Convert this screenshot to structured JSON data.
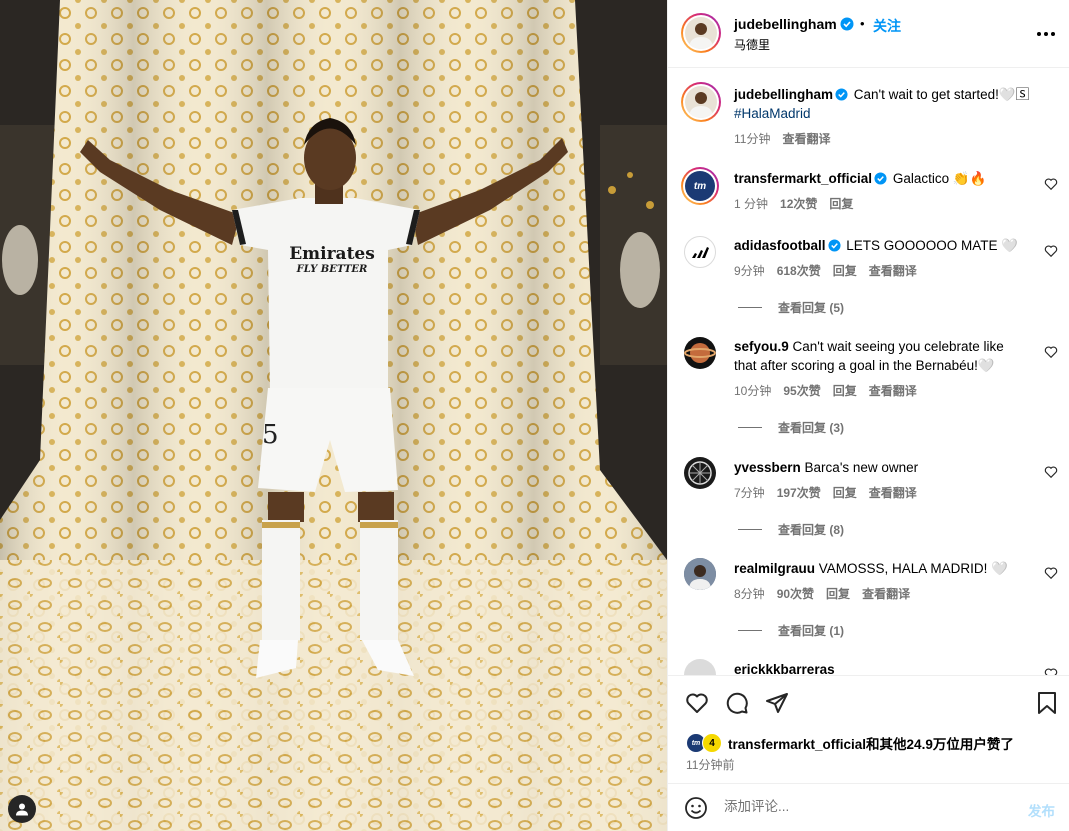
{
  "post": {
    "username": "judebellingham",
    "follow_label": "关注",
    "separator": "•",
    "location": "马德里",
    "caption_user": "judebellingham",
    "caption_text": " Can't wait to get started!🤍🅂",
    "caption_hashtag": "#HalaMadrid",
    "caption_time": "11分钟",
    "caption_translate": "查看翻译"
  },
  "comments": [
    {
      "username": "transfermarkt_official",
      "verified": true,
      "text": " Galactico 👏🔥",
      "time": "1 分钟",
      "likes": "12次赞",
      "reply": "回复",
      "translate": "",
      "replies_label": ""
    },
    {
      "username": "adidasfootball",
      "verified": true,
      "text": " LETS GOOOOOO MATE 🤍",
      "time": "9分钟",
      "likes": "618次赞",
      "reply": "回复",
      "translate": "查看翻译",
      "replies_label": "查看回复 (5)"
    },
    {
      "username": "sefyou.9",
      "verified": false,
      "text": " Can't wait seeing you celebrate like that after scoring a goal in the Bernabéu!🤍",
      "time": "10分钟",
      "likes": "95次赞",
      "reply": "回复",
      "translate": "查看翻译",
      "replies_label": "查看回复 (3)"
    },
    {
      "username": "yvessbern",
      "verified": false,
      "text": " Barca's new owner",
      "time": "7分钟",
      "likes": "197次赞",
      "reply": "回复",
      "translate": "查看翻译",
      "replies_label": "查看回复 (8)"
    },
    {
      "username": "realmilgrauu",
      "verified": false,
      "text": " VAMOSSS, HALA MADRID! 🤍",
      "time": "8分钟",
      "likes": "90次赞",
      "reply": "回复",
      "translate": "查看翻译",
      "replies_label": "查看回复 (1)"
    },
    {
      "username": "erickkkbarreras",
      "verified": false,
      "text": "",
      "time": "",
      "likes": "",
      "reply": "",
      "translate": "",
      "replies_label": ""
    }
  ],
  "likes_summary": "transfermarkt_official和其他24.9万位用户赞了",
  "post_time": "11分钟前",
  "composer": {
    "placeholder": "添加评论...",
    "post_label": "发布"
  },
  "photo": {
    "jersey_sponsor_line1": "Emirates",
    "jersey_sponsor_line2": "FLY BETTER",
    "shorts_number": "5"
  },
  "icons": {
    "verified": "verified-badge-icon",
    "more": "more-options-icon",
    "like": "heart-icon",
    "comment": "comment-icon",
    "share": "send-icon",
    "save": "bookmark-icon",
    "emoji": "emoji-icon",
    "tag": "user-tag-icon"
  },
  "colors": {
    "accent": "#0095f6",
    "secondary_text": "#737373",
    "link": "#00376b",
    "post_disabled": "#b2dffc"
  }
}
